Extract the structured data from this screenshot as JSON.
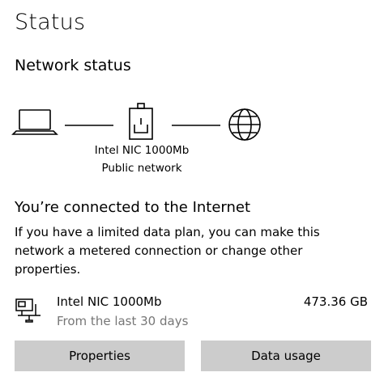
{
  "page": {
    "title": "Status"
  },
  "network_status": {
    "section_title": "Network status",
    "adapter_name": "Intel NIC 1000Mb",
    "network_type": "Public network",
    "icons": [
      "laptop-icon",
      "router-icon",
      "globe-icon"
    ]
  },
  "connection": {
    "heading": "You’re connected to the Internet",
    "description": "If you have a limited data plan, you can make this network a metered connection or change other properties."
  },
  "usage": {
    "adapter_name": "Intel NIC 1000Mb",
    "period": "From the last 30 days",
    "amount": "473.36 GB",
    "icon": "ethernet-pc-icon"
  },
  "buttons": {
    "properties": "Properties",
    "data_usage": "Data usage"
  },
  "colors": {
    "button_bg": "#cccccc",
    "secondary_text": "#767676",
    "text": "#000000"
  }
}
